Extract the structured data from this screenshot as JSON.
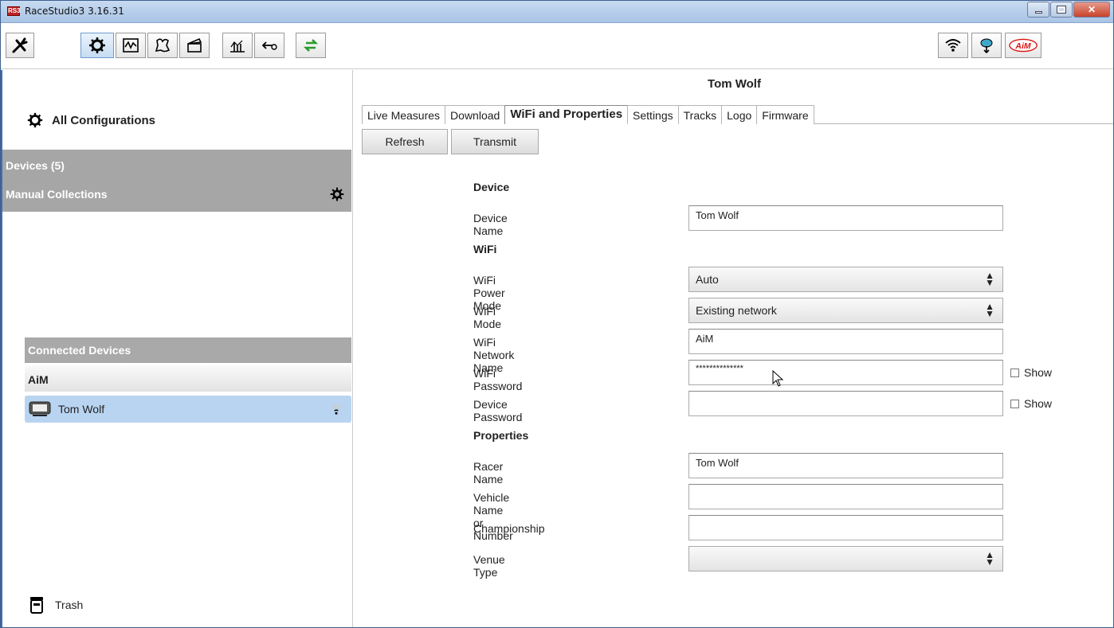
{
  "window": {
    "title": "RaceStudio3 3.16.31",
    "app_icon_text": "RS3"
  },
  "toolbar": {
    "left_icons": [
      "wrench-icon",
      "gear-sprocket-icon",
      "graph-icon",
      "track-icon",
      "clapper-icon",
      "chart-analysis-icon",
      "import-icon",
      "sync-icon"
    ],
    "right_icons": [
      "wifi-icon",
      "cloud-download-icon",
      "aim-logo"
    ],
    "logo_text": "AiM"
  },
  "sidebar": {
    "all_configurations": "All Configurations",
    "devices": "Devices  (5)",
    "manual_collections": "Manual Collections",
    "connected_devices": "Connected Devices",
    "group": "AiM",
    "device": "Tom Wolf",
    "trash": "Trash"
  },
  "main": {
    "device_title": "Tom Wolf",
    "tabs": [
      "Live Measures",
      "Download",
      "WiFi and Properties",
      "Settings",
      "Tracks",
      "Logo",
      "Firmware"
    ],
    "active_tab": "WiFi and Properties",
    "refresh": "Refresh",
    "transmit": "Transmit"
  },
  "form": {
    "device_section": "Device",
    "device_name_label": "Device Name",
    "device_name_value": "Tom Wolf",
    "wifi_section": "WiFi",
    "power_mode_label": "WiFi Power Mode",
    "power_mode_value": "Auto",
    "wifi_mode_label": "WiFi Mode",
    "wifi_mode_value": "Existing network",
    "network_name_label": "WiFi Network Name",
    "network_name_value": "AiM",
    "wifi_password_label": "WiFi Password",
    "wifi_password_value": "**************",
    "device_password_label": "Device Password",
    "device_password_value": "",
    "show_label": "Show",
    "properties_section": "Properties",
    "racer_name_label": "Racer Name",
    "racer_name_value": "Tom Wolf",
    "vehicle_label": "Vehicle Name or Number",
    "vehicle_value": "",
    "championship_label": "Championship",
    "championship_value": "",
    "venue_type_label": "Venue Type",
    "venue_type_value": ""
  }
}
